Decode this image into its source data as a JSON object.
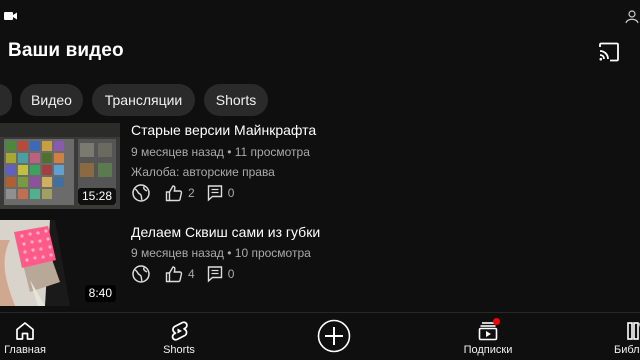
{
  "page": {
    "title": "Ваши видео"
  },
  "chips": [
    "Видео",
    "Трансляции",
    "Shorts"
  ],
  "videos": [
    {
      "title": "Старые версии Майнкрафта",
      "meta": "9 месяцев назад • 11 просмотра",
      "notice": "Жалоба: авторские права",
      "duration": "15:28",
      "likes": "2",
      "comments": "0"
    },
    {
      "title": "Делаем Сквиш сами из губки",
      "meta": "9 месяцев назад • 10 просмотра",
      "duration": "8:40",
      "likes": "4",
      "comments": "0"
    }
  ],
  "nav": {
    "home": "Главная",
    "shorts": "Shorts",
    "subscriptions": "Подписки",
    "library": "Библ"
  },
  "colors": {
    "background": "#0f0f0f",
    "chip": "#2a2a2a",
    "badge": "#ff0000",
    "secondary_text": "#aaaaaa"
  },
  "icons": [
    "video-camera-icon",
    "cast-icon",
    "globe-icon",
    "thumb-up-icon",
    "comment-icon",
    "home-icon",
    "shorts-icon",
    "add-circle-icon",
    "subscriptions-icon",
    "library-icon"
  ]
}
